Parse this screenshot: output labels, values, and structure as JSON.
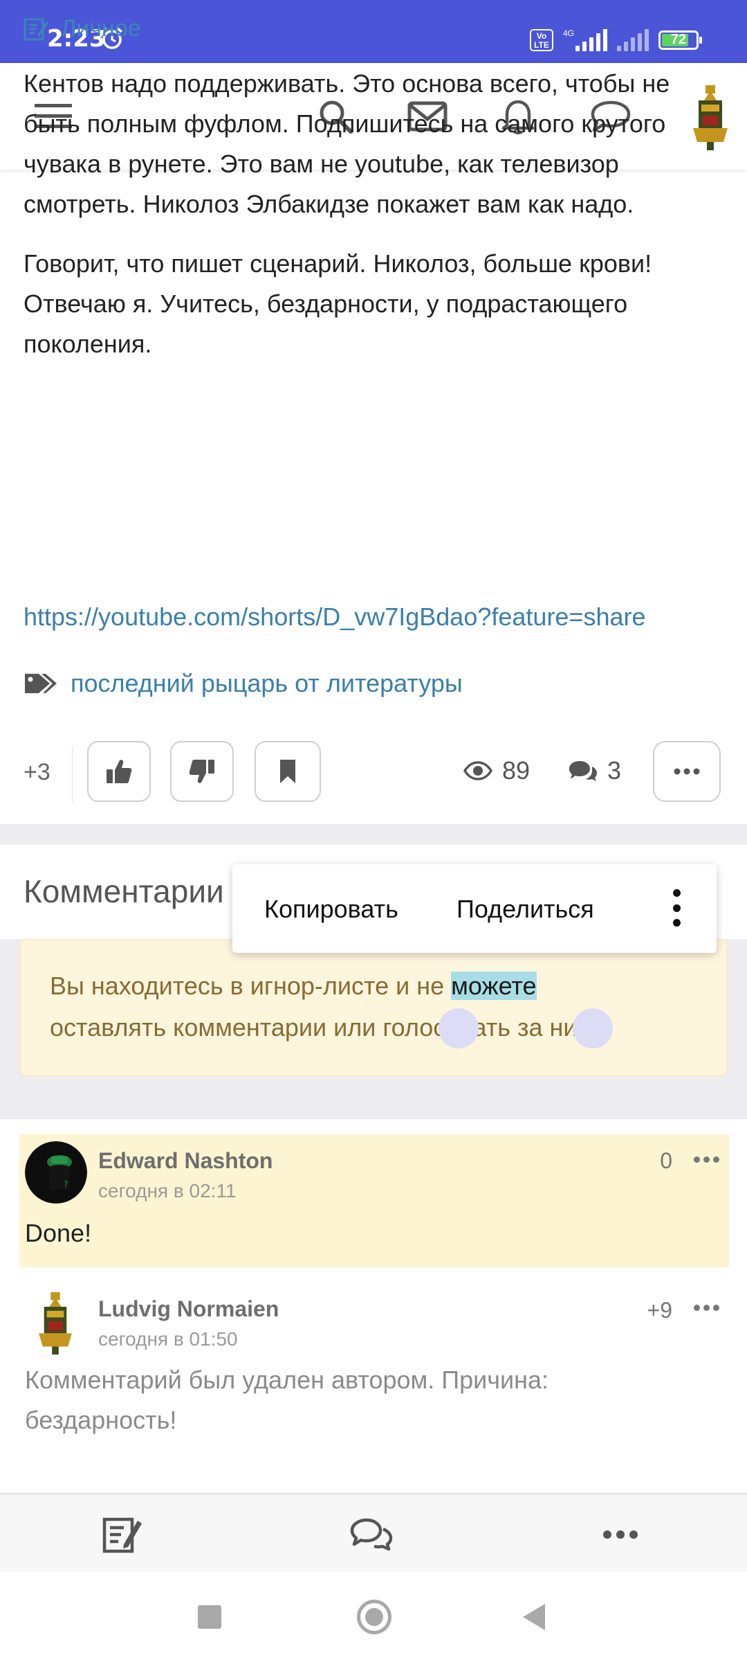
{
  "status_bar": {
    "time": "2:23",
    "volte": "Vo LTE",
    "network": "4G",
    "battery": "72"
  },
  "app_bar": {
    "icons": [
      "menu-icon",
      "search-icon",
      "mail-icon",
      "bell-icon",
      "chat-icon",
      "user-avatar"
    ]
  },
  "post": {
    "category": "Личное",
    "paragraphs": [
      "Кентов надо поддерживать. Это основа всего, чтобы не быть полным фуфлом. Подпишитесь на самого крутого чувака в рунете. Это вам не youtube, как телевизор смотреть. Николоз Элбакидзе покажет вам как надо.",
      "Говорит, что пишет сценарий. Николоз, больше крови! Отвечаю я. Учитесь, бездарности, у подрастающего поколения."
    ],
    "link": "https://youtube.com/shorts/D_vw7IgBdao?feature=share",
    "tag": "последний рыцарь от литературы",
    "rating": "+3",
    "views": "89",
    "comments_count": "3"
  },
  "comments_section": {
    "title": "Комментарии"
  },
  "context_menu": {
    "copy": "Копировать",
    "share": "Поделиться"
  },
  "notice": {
    "text_before": "Вы находитесь в игнор-листе и не ",
    "text_selected": "можете",
    "text_line2": "оставлять комментарии или голосовать за них."
  },
  "comments": [
    {
      "author": "Edward Nashton",
      "time": "сегодня в 02:11",
      "score": "0",
      "text": "Done!"
    },
    {
      "author": "Ludvig Normaien",
      "time": "сегодня в 01:50",
      "score": "+9",
      "text": "Комментарий был удален автором. Причина: бездарность!"
    }
  ],
  "colors": {
    "status_bar": "#4a55d8",
    "link": "#3a7fab",
    "notice_bg": "#fef5dd",
    "notice_text": "#876b32",
    "selection": "#a8dde6"
  }
}
